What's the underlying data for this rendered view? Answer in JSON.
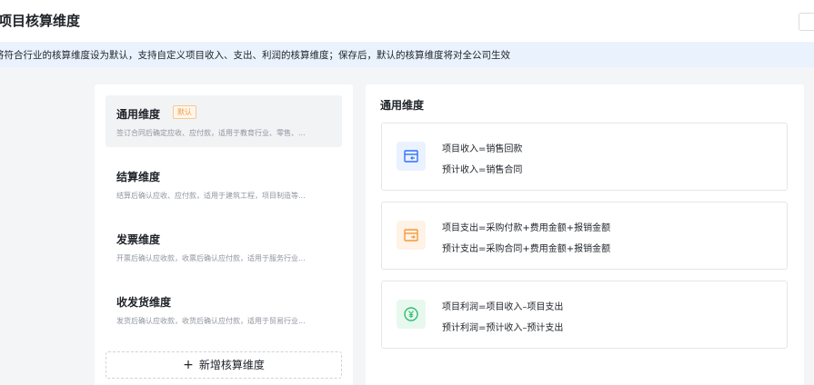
{
  "header": {
    "title": "项目核算维度"
  },
  "info": {
    "text": "将符合行业的核算维度设为默认，支持自定义项目收入、支出、利润的核算维度；保存后，默认的核算维度将对全公司生效"
  },
  "dimensions": [
    {
      "title": "通用维度",
      "badge": "默认",
      "desc": "签订合同后确定应收、应付款，适用于教育行业、零售、..."
    },
    {
      "title": "结算维度",
      "desc": "结算后确认应收、应付款，适用于建筑工程，项目制造等..."
    },
    {
      "title": "发票维度",
      "desc": "开票后确认应收款，收票后确认应付款，适用于服务行业..."
    },
    {
      "title": "收发货维度",
      "desc": "发货后确认应收款，收货后确认应付款，适用于贸易行业..."
    }
  ],
  "add_button": {
    "label": "新增核算维度",
    "icon": "plus-icon"
  },
  "detail": {
    "title": "通用维度",
    "formulas": [
      {
        "icon": "income-icon",
        "color": "#3370ff",
        "lines": [
          "项目收入=销售回款",
          "预计收入=销售合同"
        ]
      },
      {
        "icon": "expense-icon",
        "color": "#f29a3b",
        "lines": [
          "项目支出=采购付款+费用金额+报销金额",
          "预计支出=采购合同+费用金额+报销金额"
        ]
      },
      {
        "icon": "profit-icon",
        "color": "#2fbf71",
        "lines": [
          "项目利润=项目收入–项目支出",
          "预计利润=预计收入–预计支出"
        ]
      }
    ]
  }
}
